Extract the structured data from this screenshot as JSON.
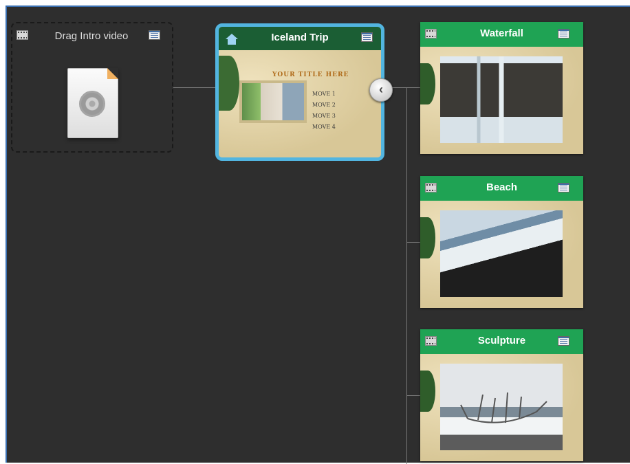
{
  "intro": {
    "label": "Drag Intro video"
  },
  "home_menu": {
    "title": "Iceland Trip",
    "template_title": "YOUR TITLE HERE",
    "menu_items": [
      "MOVE 1",
      "MOVE 2",
      "MOVE 3",
      "MOVE 4"
    ]
  },
  "collapse_button": {
    "glyph": "‹"
  },
  "nodes": [
    {
      "title": "Waterfall"
    },
    {
      "title": "Beach"
    },
    {
      "title": "Sculpture"
    }
  ],
  "icons": {
    "intro": "film-strip-icon",
    "menu": "menu-list-icon",
    "home": "home-icon",
    "file": "video-file-icon"
  }
}
